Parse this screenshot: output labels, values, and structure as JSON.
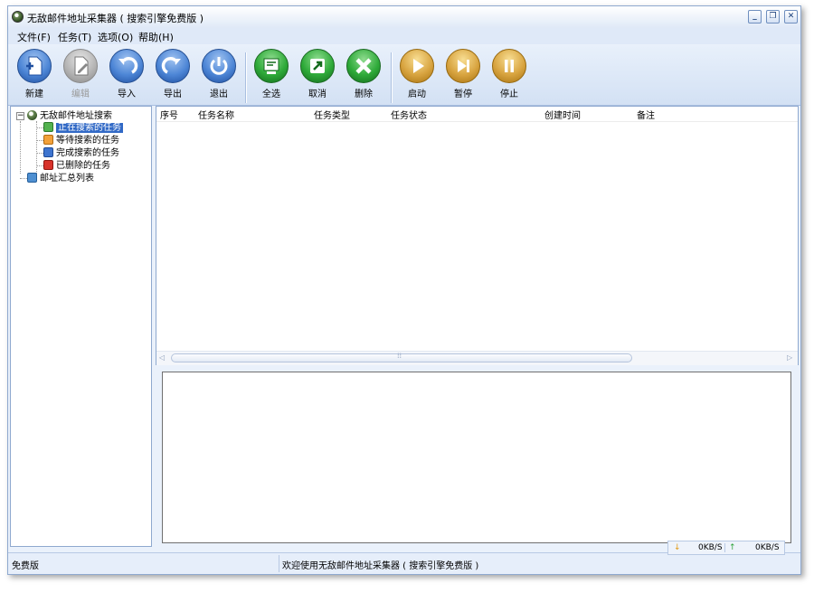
{
  "window": {
    "title": "无敌邮件地址采集器 ( 搜索引擎免费版 )",
    "controls": {
      "minimize": "_",
      "restore": "❐",
      "close": "✕"
    }
  },
  "menu": [
    {
      "label": "文件(F)"
    },
    {
      "label": "任务(T)"
    },
    {
      "label": "选项(O)"
    },
    {
      "label": "帮助(H)"
    }
  ],
  "toolbar": {
    "buttons": [
      {
        "label": "新建",
        "icon": "new-document-icon",
        "enabled": true
      },
      {
        "label": "编辑",
        "icon": "edit-document-icon",
        "enabled": false
      },
      {
        "label": "导入",
        "icon": "import-arrow-icon",
        "enabled": true
      },
      {
        "label": "导出",
        "icon": "export-arrow-icon",
        "enabled": true
      },
      {
        "label": "退出",
        "icon": "power-icon",
        "enabled": true
      },
      {
        "label": "全选",
        "icon": "select-all-icon",
        "enabled": true
      },
      {
        "label": "取消",
        "icon": "cancel-icon",
        "enabled": true
      },
      {
        "label": "删除",
        "icon": "delete-x-icon",
        "enabled": true
      },
      {
        "label": "启动",
        "icon": "play-icon",
        "enabled": true
      },
      {
        "label": "暂停",
        "icon": "pause-skip-icon",
        "enabled": true
      },
      {
        "label": "停止",
        "icon": "stop-icon",
        "enabled": true
      }
    ],
    "colors": {
      "blue": "#4d86d6",
      "green": "#2eaa39",
      "gold": "#d8a440"
    }
  },
  "tree": {
    "expander": "−",
    "root": "无敌邮件地址搜索",
    "children": [
      {
        "label": "正在搜索的任务",
        "icon": "search-task-icon",
        "selected": true
      },
      {
        "label": "等待搜索的任务",
        "icon": "waiting-task-icon"
      },
      {
        "label": "完成搜索的任务",
        "icon": "done-check-icon"
      },
      {
        "label": "已删除的任务",
        "icon": "deleted-x-icon"
      }
    ],
    "summary": "邮址汇总列表"
  },
  "table": {
    "columns": [
      "序号",
      "任务名称",
      "任务类型",
      "任务状态",
      "创建时间",
      "备注"
    ],
    "rows": []
  },
  "scroll": {
    "grip": "⁞⁞"
  },
  "status": {
    "edition": "免费版",
    "message": "欢迎使用无敌邮件地址采集器 ( 搜索引擎免费版 )",
    "download_speed": "0KB/S",
    "upload_speed": "0KB/S"
  }
}
